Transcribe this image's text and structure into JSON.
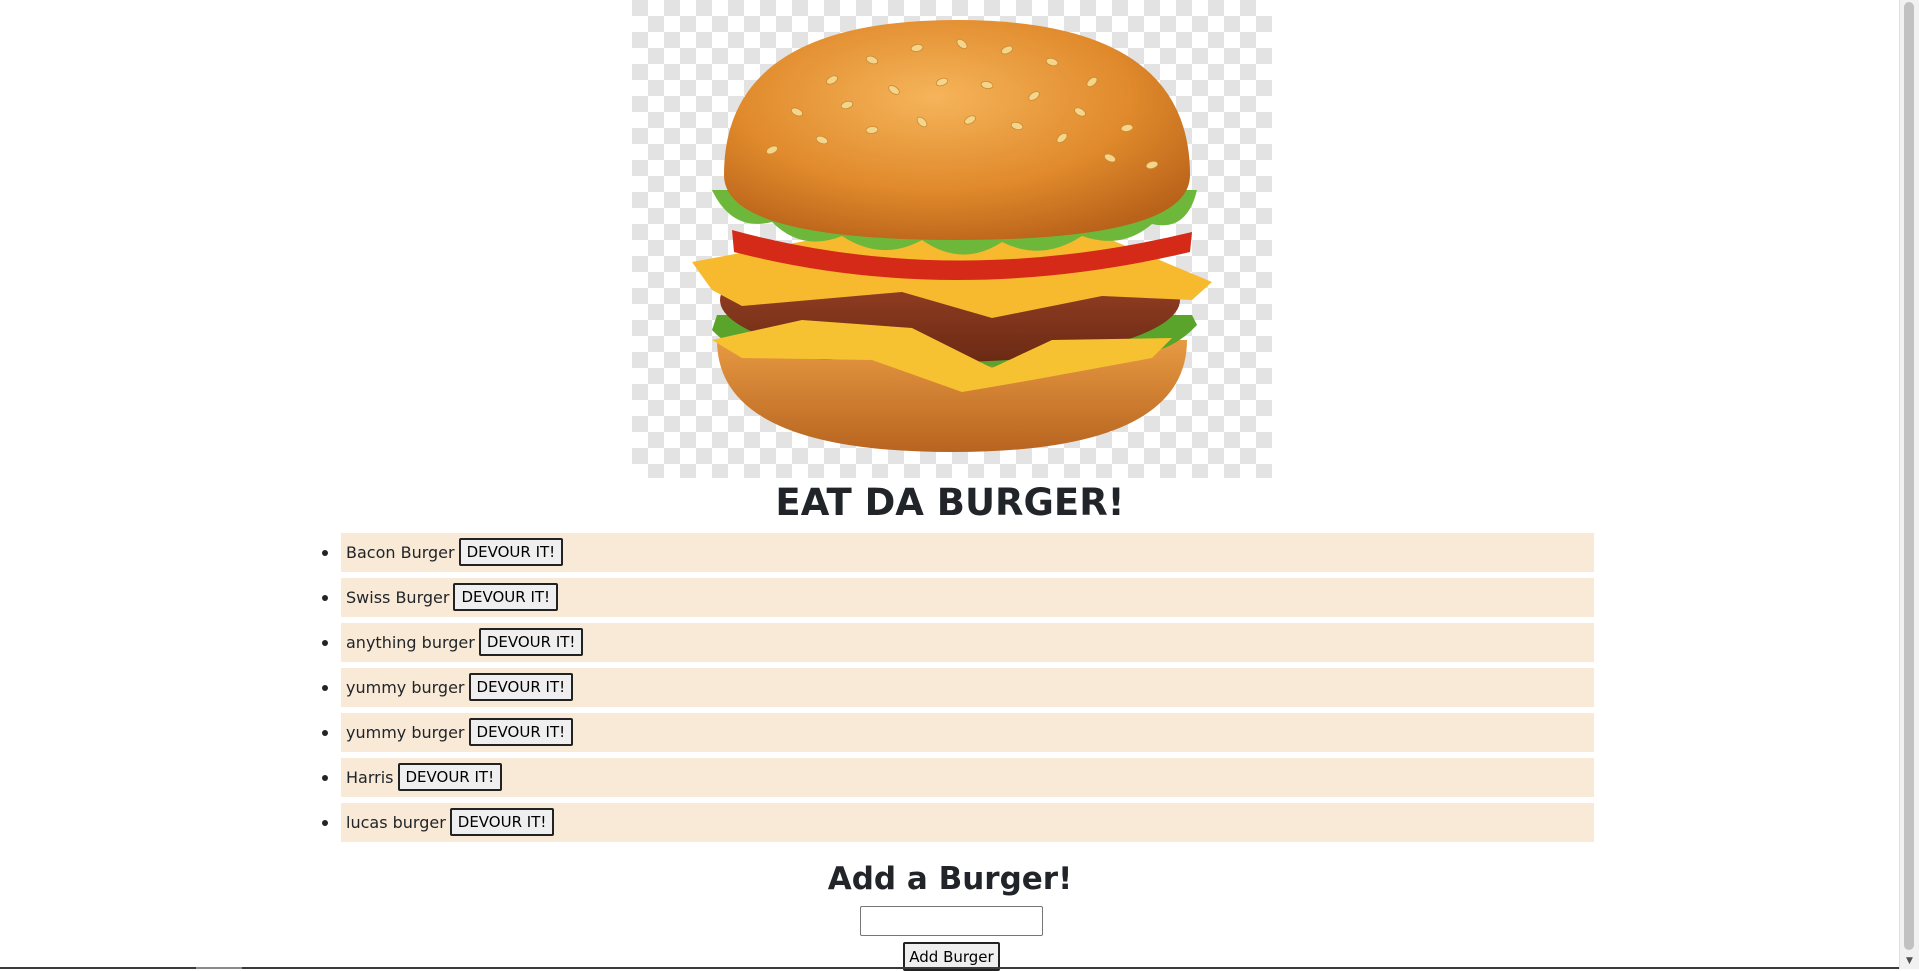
{
  "header": {
    "title": "EAT DA BURGER!"
  },
  "burgers": [
    {
      "name": "Bacon Burger",
      "action": "DEVOUR IT!"
    },
    {
      "name": "Swiss Burger",
      "action": "DEVOUR IT!"
    },
    {
      "name": "anything burger",
      "action": "DEVOUR IT!"
    },
    {
      "name": "yummy burger",
      "action": "DEVOUR IT!"
    },
    {
      "name": "yummy burger",
      "action": "DEVOUR IT!"
    },
    {
      "name": "Harris",
      "action": "DEVOUR IT!"
    },
    {
      "name": "lucas burger",
      "action": "DEVOUR IT!"
    }
  ],
  "add_form": {
    "title": "Add a Burger!",
    "input_value": "",
    "button_label": "Add Burger"
  },
  "colors": {
    "list_item_bg": "#f9e9d7",
    "text": "#212529"
  }
}
